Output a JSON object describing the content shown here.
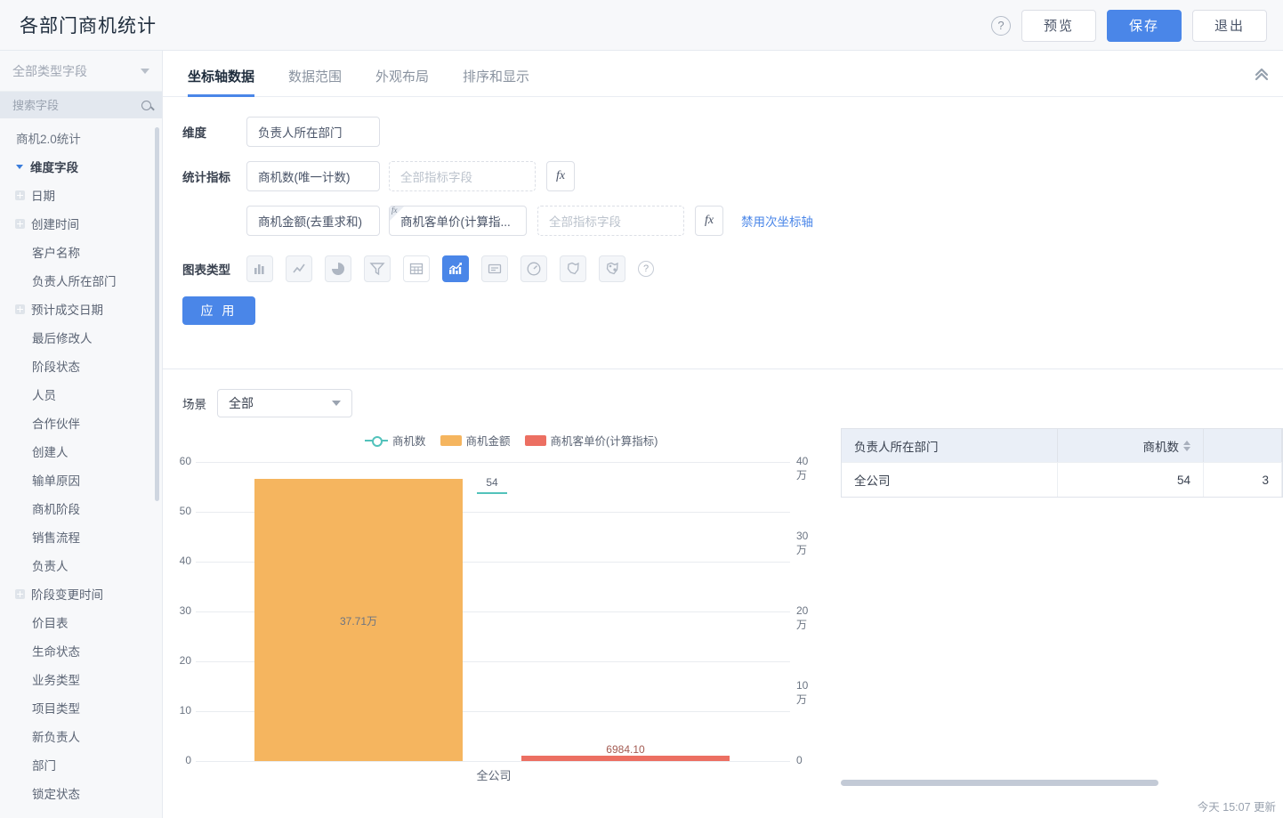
{
  "header": {
    "title": "各部门商机统计",
    "help_icon": "question-circle-icon",
    "preview_label": "预览",
    "save_label": "保存",
    "exit_label": "退出"
  },
  "sidebar": {
    "type_filter_label": "全部类型字段",
    "search_placeholder": "搜索字段",
    "items": [
      {
        "label": "商机2.0统计",
        "kind": "root"
      },
      {
        "label": "维度字段",
        "kind": "group",
        "icon": "caret-down-icon"
      },
      {
        "label": "日期",
        "kind": "expandable",
        "icon": "plus-box-icon"
      },
      {
        "label": "创建时间",
        "kind": "expandable",
        "icon": "plus-box-icon"
      },
      {
        "label": "客户名称",
        "kind": "leaf"
      },
      {
        "label": "负责人所在部门",
        "kind": "leaf"
      },
      {
        "label": "预计成交日期",
        "kind": "expandable",
        "icon": "plus-box-icon"
      },
      {
        "label": "最后修改人",
        "kind": "leaf"
      },
      {
        "label": "阶段状态",
        "kind": "leaf"
      },
      {
        "label": "人员",
        "kind": "leaf"
      },
      {
        "label": "合作伙伴",
        "kind": "leaf"
      },
      {
        "label": "创建人",
        "kind": "leaf"
      },
      {
        "label": "输单原因",
        "kind": "leaf"
      },
      {
        "label": "商机阶段",
        "kind": "leaf"
      },
      {
        "label": "销售流程",
        "kind": "leaf"
      },
      {
        "label": "负责人",
        "kind": "leaf"
      },
      {
        "label": "阶段变更时间",
        "kind": "expandable",
        "icon": "plus-box-icon"
      },
      {
        "label": "价目表",
        "kind": "leaf"
      },
      {
        "label": "生命状态",
        "kind": "leaf"
      },
      {
        "label": "业务类型",
        "kind": "leaf"
      },
      {
        "label": "项目类型",
        "kind": "leaf"
      },
      {
        "label": "新负责人",
        "kind": "leaf"
      },
      {
        "label": "部门",
        "kind": "leaf"
      },
      {
        "label": "锁定状态",
        "kind": "leaf"
      }
    ]
  },
  "panel": {
    "tabs": [
      {
        "label": "坐标轴数据",
        "active": true
      },
      {
        "label": "数据范围",
        "active": false
      },
      {
        "label": "外观布局",
        "active": false
      },
      {
        "label": "排序和显示",
        "active": false
      }
    ],
    "collapse_icon": "double-chevron-up-icon",
    "dimension": {
      "label": "维度",
      "value": "负责人所在部门"
    },
    "metrics": {
      "label": "统计指标",
      "row1": {
        "value": "商机数(唯一计数)",
        "placeholder": "全部指标字段",
        "fx_label": "fx"
      },
      "row2": {
        "value": "商机金额(去重求和)",
        "calc_value": "商机客单价(计算指...",
        "calc_tag": "fx",
        "placeholder": "全部指标字段",
        "fx_label": "fx",
        "disable_axis_link": "禁用次坐标轴"
      }
    },
    "chart_type": {
      "label": "图表类型",
      "options": [
        {
          "name": "bar-chart-icon",
          "active": false
        },
        {
          "name": "line-chart-icon",
          "active": false
        },
        {
          "name": "pie-chart-icon",
          "active": false
        },
        {
          "name": "funnel-chart-icon",
          "active": false
        },
        {
          "name": "table-chart-icon",
          "active": false,
          "white": true
        },
        {
          "name": "combo-chart-icon",
          "active": true
        },
        {
          "name": "label-chart-icon",
          "active": false
        },
        {
          "name": "gauge-chart-icon",
          "active": false
        },
        {
          "name": "map-chart-icon",
          "active": false
        },
        {
          "name": "map-point-chart-icon",
          "active": false
        }
      ],
      "help_icon": "question-circle-icon"
    },
    "apply_label": "应 用"
  },
  "chart_area": {
    "scene_label": "场景",
    "scene_value": "全部",
    "scene_chevron": "chevron-down-icon"
  },
  "chart_data": {
    "type": "bar",
    "title": "",
    "categories": [
      "全公司"
    ],
    "series": [
      {
        "name": "商机数",
        "type": "line",
        "color": "#52c2bb",
        "axis": "left",
        "values": [
          54
        ],
        "labels": [
          "54"
        ]
      },
      {
        "name": "商机金额",
        "type": "bar",
        "color": "#f5b55f",
        "axis": "right",
        "values": [
          377100
        ],
        "labels": [
          "37.71万"
        ]
      },
      {
        "name": "商机客单价(计算指标)",
        "type": "bar",
        "color": "#ec6f62",
        "axis": "right",
        "values": [
          6984.1
        ],
        "labels": [
          "6984.10"
        ]
      }
    ],
    "yaxis_left": {
      "ticks": [
        "60",
        "50",
        "40",
        "30",
        "20",
        "10",
        "0"
      ],
      "min": 0,
      "max": 60
    },
    "yaxis_right": {
      "ticks": [
        "40万",
        "30万",
        "20万",
        "10万",
        "0"
      ],
      "min": 0,
      "max": 400000
    },
    "xlabel": "",
    "ylabel": "",
    "grid": true,
    "legend_position": "top"
  },
  "data_table": {
    "columns": [
      "负责人所在部门",
      "商机数",
      ""
    ],
    "sort_icon": "sort-arrows-icon",
    "rows": [
      {
        "cells": [
          "全公司",
          "54",
          "3"
        ]
      }
    ]
  },
  "footer": {
    "updated_text": "今天 15:07 更新"
  }
}
